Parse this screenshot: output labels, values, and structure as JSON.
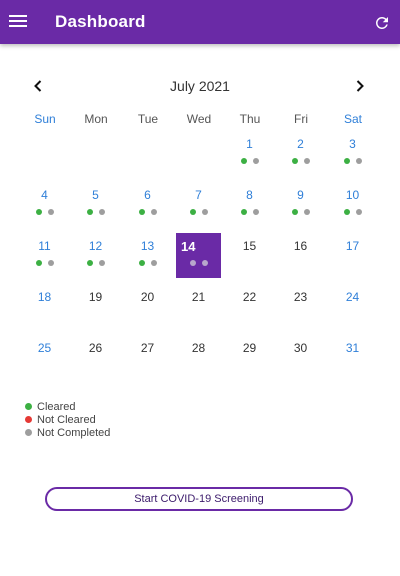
{
  "appbar": {
    "title": "Dashboard",
    "menu_icon": "menu-icon",
    "refresh_icon": "refresh-icon"
  },
  "calendar": {
    "month_title": "July 2021",
    "weekdays": [
      "Sun",
      "Mon",
      "Tue",
      "Wed",
      "Thu",
      "Fri",
      "Sat"
    ],
    "selected_day": "14",
    "weeks": [
      [
        null,
        null,
        null,
        null,
        {
          "day": "1",
          "dots": [
            "green",
            "gray"
          ]
        },
        {
          "day": "2",
          "dots": [
            "green",
            "gray"
          ]
        },
        {
          "day": "3",
          "dots": [
            "green",
            "gray"
          ]
        }
      ],
      [
        {
          "day": "4",
          "dots": [
            "green",
            "gray"
          ]
        },
        {
          "day": "5",
          "dots": [
            "green",
            "gray"
          ]
        },
        {
          "day": "6",
          "dots": [
            "green",
            "gray"
          ]
        },
        {
          "day": "7",
          "dots": [
            "green",
            "gray"
          ]
        },
        {
          "day": "8",
          "dots": [
            "green",
            "gray"
          ]
        },
        {
          "day": "9",
          "dots": [
            "green",
            "gray"
          ]
        },
        {
          "day": "10",
          "dots": [
            "green",
            "gray"
          ]
        }
      ],
      [
        {
          "day": "11",
          "dots": [
            "green",
            "gray"
          ]
        },
        {
          "day": "12",
          "dots": [
            "green",
            "gray"
          ]
        },
        {
          "day": "13",
          "dots": [
            "green",
            "gray"
          ]
        },
        {
          "day": "14",
          "dots": [
            "gray",
            "gray"
          ]
        },
        {
          "day": "15",
          "dots": []
        },
        {
          "day": "16",
          "dots": []
        },
        {
          "day": "17",
          "dots": []
        }
      ],
      [
        {
          "day": "18",
          "dots": []
        },
        {
          "day": "19",
          "dots": []
        },
        {
          "day": "20",
          "dots": []
        },
        {
          "day": "21",
          "dots": []
        },
        {
          "day": "22",
          "dots": []
        },
        {
          "day": "23",
          "dots": []
        },
        {
          "day": "24",
          "dots": []
        }
      ],
      [
        {
          "day": "25",
          "dots": []
        },
        {
          "day": "26",
          "dots": []
        },
        {
          "day": "27",
          "dots": []
        },
        {
          "day": "28",
          "dots": []
        },
        {
          "day": "29",
          "dots": []
        },
        {
          "day": "30",
          "dots": []
        },
        {
          "day": "31",
          "dots": []
        }
      ]
    ]
  },
  "legend": [
    {
      "label": "Cleared",
      "color": "#3cb043"
    },
    {
      "label": "Not Cleared",
      "color": "#e53935"
    },
    {
      "label": "Not Completed",
      "color": "#9e9e9e"
    }
  ],
  "actions": {
    "start_screening_label": "Start COVID-19 Screening"
  },
  "colors": {
    "primary": "#6a2aa6",
    "weekend_blue": "#2f7fd8"
  }
}
